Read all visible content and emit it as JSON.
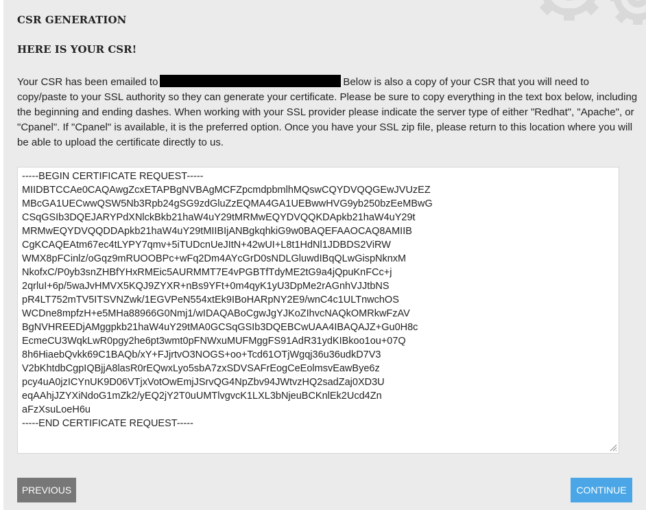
{
  "page": {
    "section_title": "CSR GENERATION",
    "sub_title": "HERE IS YOUR CSR!"
  },
  "intro": {
    "before_email": "Your CSR has been emailed to",
    "after_email": "Below is also a copy of your CSR that you will need to copy/paste to your SSL authority so they can generate your certificate. Please be sure to copy everything in the text box below, including the beginning and ending dashes. When working with your SSL provider please indicate the server type of either \"Redhat\", \"Apache\", or \"Cpanel\". If \"Cpanel\" is available, it is the preferred option. Once you have your SSL zip file, please return to this location where you will be able to upload the certificate directly to us."
  },
  "csr": {
    "text": "-----BEGIN CERTIFICATE REQUEST-----\nMIIDBTCCAe0CAQAwgZcxETAPBgNVBAgMCFZpcmdpbmlhMQswCQYDVQQGEwJVUzEZ\nMBcGA1UECwwQSW5Nb3Rpb24gSG9zdGluZzEQMA4GA1UEBwwHVG9yb250bzEeMBwG\nCSqGSIb3DQEJARYPdXNlckBkb21haW4uY29tMRMwEQYDVQQKDApkb21haW4uY29t\nMRMwEQYDVQQDDApkb21haW4uY29tMIIBIjANBgkqhkiG9w0BAQEFAAOCAQ8AMIIB\nCgKCAQEAtm67ec4tLYPY7qmv+5iTUDcnUeJItN+42wUI+L8t1HdNl1JDBDS2ViRW\nWMX8pFCinlz/oGqz9mRUOOBPc+wFq2Dm4AYcGrD0sNDLGluwdIBqQLwGispNknxM\nNkofxC/P0yb3snZHBfYHxRMEic5AURMMT7E4vPGBTfTdyME2tG9a4jQpuKnFCc+j\n2qrluI+6p/5waJvHMVX5KQJ9ZYXR+nBs9YFt+0m4qyK1yU3DpMe2rAGnhVJJtbNS\npR4LT752mTV5ITSVNZwk/1EGVPeN554xtEk9IBoHARpNY2E9/wnC4c1ULTnwchOS\nWCDne8mpfzH+e5MHa88966G0Nmj1/wIDAQABoCgwJgYJKoZIhvcNAQkOMRkwFzAV\nBgNVHREEDjAMggpkb21haW4uY29tMA0GCSqGSIb3DQEBCwUAA4IBAQAJZ+Gu0H8c\nEcmeCU3WqkLwR0pgy2he6pt3wmt0pFNWxuMUFMggFS91AdR31ydKIBkoo1ou+07Q\n8h6HiaebQvkk69C1BAQb/xY+FJjrtvO3NOGS+oo+Tcd61OTjWgqj36u36udkD7V3\nV2bKhtdbCgpIQBjjA8lasR0rEQwxLyo5sbA7zxSDVSAFrEogCeEolmsvEawBye6z\npcy4uA0jzICYnUK9D06VTjxVotOwEmjJSrvQG4NpZbv94JWtvzHQ2sadZaj0XD3U\neqAAhjJZYXiNdoG1mZk2/yEQ2jY2T0uUMTlvgvcK1LXL3bNjeuBCKnlEk2Ucd4Zn\naFzXsuLoeH6u\n-----END CERTIFICATE REQUEST-----"
  },
  "buttons": {
    "previous_label": "PREVIOUS",
    "continue_label": "CONTINUE"
  },
  "colors": {
    "panel_background": "#ebebeb",
    "previous_button": "#777777",
    "continue_button": "#4aa6e6",
    "redaction": "#000000"
  },
  "icons": {
    "background": "gear-icon",
    "textarea_corner": "resize-grip-icon"
  }
}
